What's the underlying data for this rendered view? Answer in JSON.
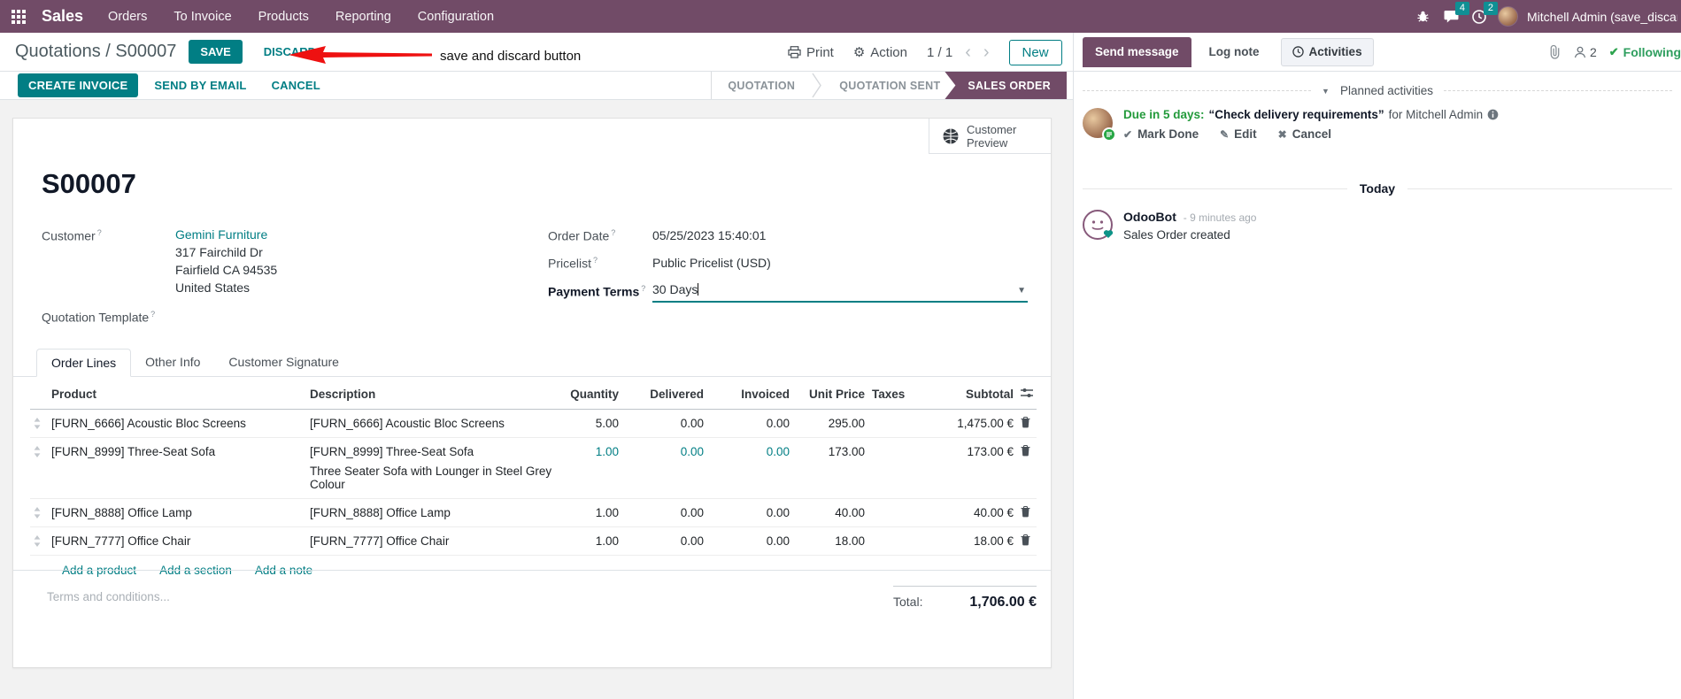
{
  "colors": {
    "brand": "#714B67",
    "accent": "#017e84",
    "badge": "#0f8f94",
    "arrow_red": "#ee1111",
    "activity_green": "#239a3b"
  },
  "topbar": {
    "app_name": "Sales",
    "menus": [
      "Orders",
      "To Invoice",
      "Products",
      "Reporting",
      "Configuration"
    ],
    "message_badge": "4",
    "activity_badge": "2",
    "user_name": "Mitchell Admin (save_discar"
  },
  "breadcrumb": {
    "path": "Quotations / S00007",
    "save": "SAVE",
    "discard": "DISCARD",
    "print": "Print",
    "action": "Action",
    "pager": "1 / 1",
    "new": "New"
  },
  "annotation": {
    "label": "save and discard button"
  },
  "statusbar": {
    "create_invoice": "CREATE INVOICE",
    "send_by_email": "SEND BY EMAIL",
    "cancel": "CANCEL",
    "pipeline": [
      {
        "label": "QUOTATION",
        "active": false
      },
      {
        "label": "QUOTATION SENT",
        "active": false
      },
      {
        "label": "SALES ORDER",
        "active": true
      }
    ]
  },
  "form": {
    "customer_preview": "Customer Preview",
    "title": "S00007",
    "help_mark": "?",
    "customer_label": "Customer",
    "customer_name": "Gemini Furniture",
    "address": [
      "317 Fairchild Dr",
      "Fairfield CA 94535",
      "United States"
    ],
    "quotation_template_label": "Quotation Template",
    "order_date_label": "Order Date",
    "order_date": "05/25/2023 15:40:01",
    "pricelist_label": "Pricelist",
    "pricelist": "Public Pricelist (USD)",
    "payment_terms_label": "Payment Terms",
    "payment_terms": "30 Days"
  },
  "tabs": [
    {
      "label": "Order Lines",
      "active": true
    },
    {
      "label": "Other Info",
      "active": false
    },
    {
      "label": "Customer Signature",
      "active": false
    }
  ],
  "order_lines": {
    "columns": [
      "Product",
      "Description",
      "Quantity",
      "Delivered",
      "Invoiced",
      "Unit Price",
      "Taxes",
      "Subtotal"
    ],
    "rows": [
      {
        "product": "[FURN_6666] Acoustic Bloc Screens",
        "description": "[FURN_6666] Acoustic Bloc Screens",
        "description2": "",
        "quantity": "5.00",
        "delivered": "0.00",
        "invoiced": "0.00",
        "unit_price": "295.00",
        "taxes": "",
        "subtotal": "1,475.00 €",
        "highlight": false
      },
      {
        "product": "[FURN_8999] Three-Seat Sofa",
        "description": "[FURN_8999] Three-Seat Sofa",
        "description2": "Three Seater Sofa with Lounger in Steel Grey Colour",
        "quantity": "1.00",
        "delivered": "0.00",
        "invoiced": "0.00",
        "unit_price": "173.00",
        "taxes": "",
        "subtotal": "173.00 €",
        "highlight": true
      },
      {
        "product": "[FURN_8888] Office Lamp",
        "description": "[FURN_8888] Office Lamp",
        "description2": "",
        "quantity": "1.00",
        "delivered": "0.00",
        "invoiced": "0.00",
        "unit_price": "40.00",
        "taxes": "",
        "subtotal": "40.00 €",
        "highlight": false
      },
      {
        "product": "[FURN_7777] Office Chair",
        "description": "[FURN_7777] Office Chair",
        "description2": "",
        "quantity": "1.00",
        "delivered": "0.00",
        "invoiced": "0.00",
        "unit_price": "18.00",
        "taxes": "",
        "subtotal": "18.00 €",
        "highlight": false
      }
    ],
    "links": [
      "Add a product",
      "Add a section",
      "Add a note"
    ],
    "terms_placeholder": "Terms and conditions...",
    "total_label": "Total:",
    "total_value": "1,706.00 €"
  },
  "chatter": {
    "send_message": "Send message",
    "log_note": "Log note",
    "activities": "Activities",
    "followers_count": "2",
    "following": "Following",
    "planned_activities": "Planned activities",
    "activity": {
      "due": "Due in 5 days:",
      "summary": "“Check delivery requirements”",
      "for_text": "for Mitchell Admin",
      "mark_done": "Mark Done",
      "edit": "Edit",
      "cancel": "Cancel"
    },
    "today": "Today",
    "message": {
      "author": "OdooBot",
      "time": "- 9 minutes ago",
      "body": "Sales Order created"
    }
  }
}
